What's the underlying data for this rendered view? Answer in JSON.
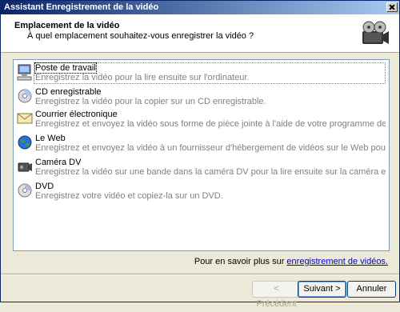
{
  "window": {
    "title": "Assistant Enregistrement de la vidéo"
  },
  "header": {
    "title": "Emplacement de la vidéo",
    "subtitle": "À quel emplacement souhaitez-vous enregistrer la vidéo ?",
    "icon": "film-reel-icon"
  },
  "destinations": [
    {
      "name": "Poste de travail",
      "description": "Enregistrez la vidéo pour la lire ensuite sur l'ordinateur.",
      "icon": "computer-icon",
      "selected": true
    },
    {
      "name": "CD enregistrable",
      "description": "Enregistrez la vidéo pour la copier sur un CD enregistrable.",
      "icon": "cd-icon",
      "selected": false
    },
    {
      "name": "Courrier électronique",
      "description": "Enregistrez et envoyez la vidéo sous forme de pièce jointe à l'aide de votre programme de messagerie par défaut.",
      "icon": "envelope-icon",
      "selected": false
    },
    {
      "name": "Le Web",
      "description": "Enregistrez et envoyez la vidéo à un fournisseur d'hébergement de vidéos sur le Web pour permettre à d'autres personn...",
      "icon": "globe-icon",
      "selected": false
    },
    {
      "name": "Caméra DV",
      "description": "Enregistrez la vidéo sur une bande dans la caméra DV pour la lire ensuite sur la caméra elle-même ou pour la regarder sur ...",
      "icon": "camera-icon",
      "selected": false
    },
    {
      "name": "DVD",
      "description": "Enregistrez votre vidéo et copiez-la sur un DVD.",
      "icon": "dvd-icon",
      "selected": false
    }
  ],
  "learn_more": {
    "prefix": "Pour en savoir plus sur",
    "link": "enregistrement de vidéos."
  },
  "buttons": {
    "back": "< Précédent",
    "next": "Suivant >",
    "cancel": "Annuler"
  }
}
